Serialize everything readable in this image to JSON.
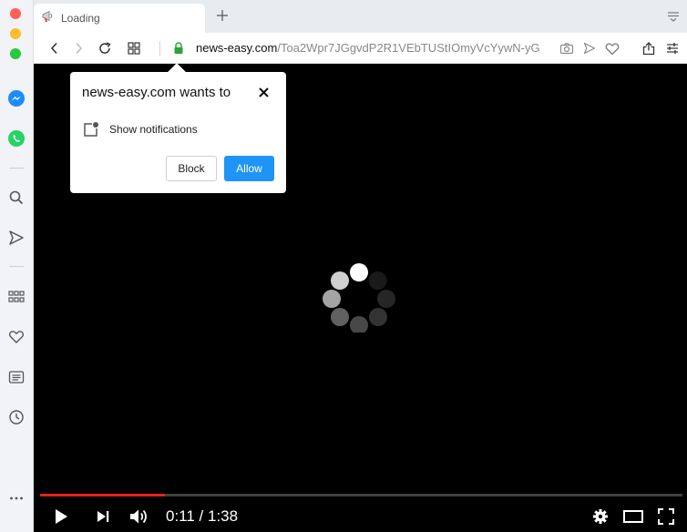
{
  "tab": {
    "title": "Loading"
  },
  "address_bar": {
    "host": "news-easy.com",
    "path": "/Toa2Wpr7JGgvdP2R1VEbTUStIOmyVcYywN-yG"
  },
  "notification_prompt": {
    "title": "news-easy.com wants to",
    "permission": "Show notifications",
    "block_label": "Block",
    "allow_label": "Allow",
    "allow_color": "#1e94f7"
  },
  "player": {
    "time_display": "0:11 / 1:38",
    "progress_fraction": 0.195,
    "progress_color": "#e62117"
  },
  "sidebar": {
    "icons": [
      "messenger-icon",
      "whatsapp-icon",
      "search-icon",
      "send-icon",
      "speed-dial-icon",
      "heart-icon",
      "news-icon",
      "history-icon",
      "more-icon"
    ]
  },
  "colors": {
    "messenger": "#1a8cff",
    "whatsapp": "#25d366",
    "lock": "#2aa33a"
  }
}
